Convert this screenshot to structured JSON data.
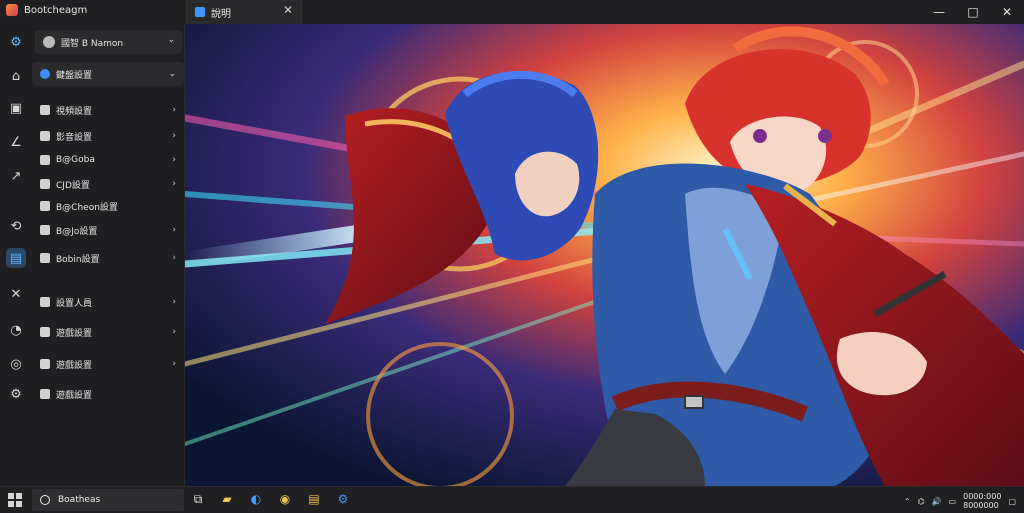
{
  "app": {
    "title": "Bootcheagm",
    "tab_label": "說明"
  },
  "window_controls": {
    "minimize": "—",
    "maximize": "□",
    "close": "✕"
  },
  "profile": {
    "label": "國智 B Namon"
  },
  "sidebar": {
    "header": {
      "label": "鍵盤設置"
    },
    "items": [
      {
        "label": "視頻設置",
        "has_chevron": true
      },
      {
        "label": "影音設置",
        "has_chevron": true
      },
      {
        "label": "B@Goba",
        "has_chevron": true
      },
      {
        "label": "CJD設置",
        "has_chevron": true
      },
      {
        "label": "B@Cheon設置",
        "has_chevron": false
      },
      {
        "label": "B@Jo設置",
        "has_chevron": true
      },
      {
        "label": "Bobin設置",
        "has_chevron": true
      },
      {
        "label": "設置人員",
        "has_chevron": true
      },
      {
        "label": "遊戲設置",
        "has_chevron": true
      },
      {
        "label": "遊戲設置",
        "has_chevron": true
      },
      {
        "label": "遊戲設置",
        "has_chevron": false
      }
    ]
  },
  "taskbar": {
    "search_label": "Boatheas",
    "time": "0000:000",
    "date": "8000000",
    "tray_icons": [
      "chevron-up-icon",
      "network-icon",
      "volume-icon",
      "battery-icon",
      "notification-icon"
    ]
  },
  "colors": {
    "accent": "#3e95ff",
    "window_bg": "#1b1b1d",
    "sidebar_bg": "#1f1f22",
    "selected_bg": "#2b4868"
  }
}
